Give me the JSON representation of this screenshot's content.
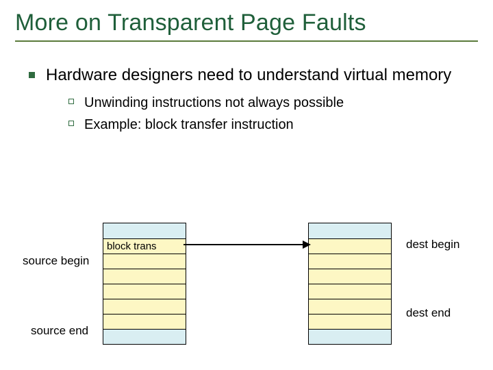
{
  "title": "More on Transparent Page Faults",
  "bullet": "Hardware designers need to understand virtual memory",
  "sub1": "Unwinding instructions not always possible",
  "sub2": "Example:  block transfer instruction",
  "labels": {
    "block_trans": "block trans",
    "source_begin": "source begin",
    "source_end": "source end",
    "dest_begin": "dest begin",
    "dest_end": "dest end"
  }
}
